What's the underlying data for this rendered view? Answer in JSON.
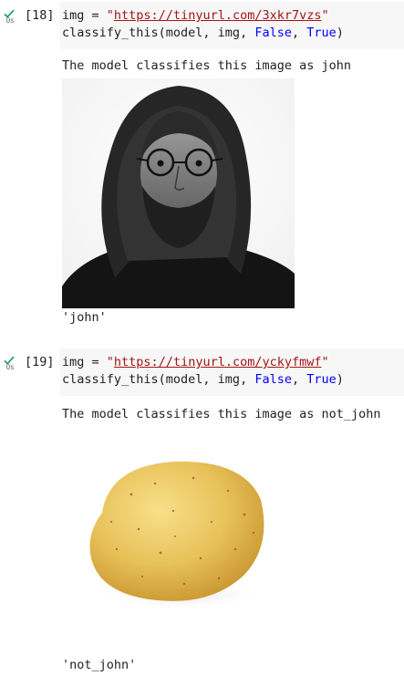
{
  "cells": [
    {
      "exec_count": "[18]",
      "status_time": "0s",
      "code": {
        "line1": {
          "var": "img",
          "op": " = ",
          "q1": "\"",
          "url": "https://tinyurl.com/3xkr7vzs",
          "q2": "\""
        },
        "line2": {
          "prefix": "classify_this(model, img, ",
          "arg1": "False",
          "sep": ", ",
          "arg2": "True",
          "suffix": ")"
        }
      },
      "output_text": "The model classifies this image as john",
      "result": "'john'"
    },
    {
      "exec_count": "[19]",
      "status_time": "0s",
      "code": {
        "line1": {
          "var": "img",
          "op": " = ",
          "q1": "\"",
          "url": "https://tinyurl.com/yckyfmwf",
          "q2": "\""
        },
        "line2": {
          "prefix": "classify_this(model, img, ",
          "arg1": "False",
          "sep": ", ",
          "arg2": "True",
          "suffix": ")"
        }
      },
      "output_text": "The model classifies this image as not_john",
      "result": "'not_john'"
    }
  ],
  "colors": {
    "string": "#a31515",
    "keyword": "#0000ff",
    "check": "#0f9d58",
    "code_bg": "#f7f7f7"
  },
  "icons": {
    "status": "check-icon"
  }
}
